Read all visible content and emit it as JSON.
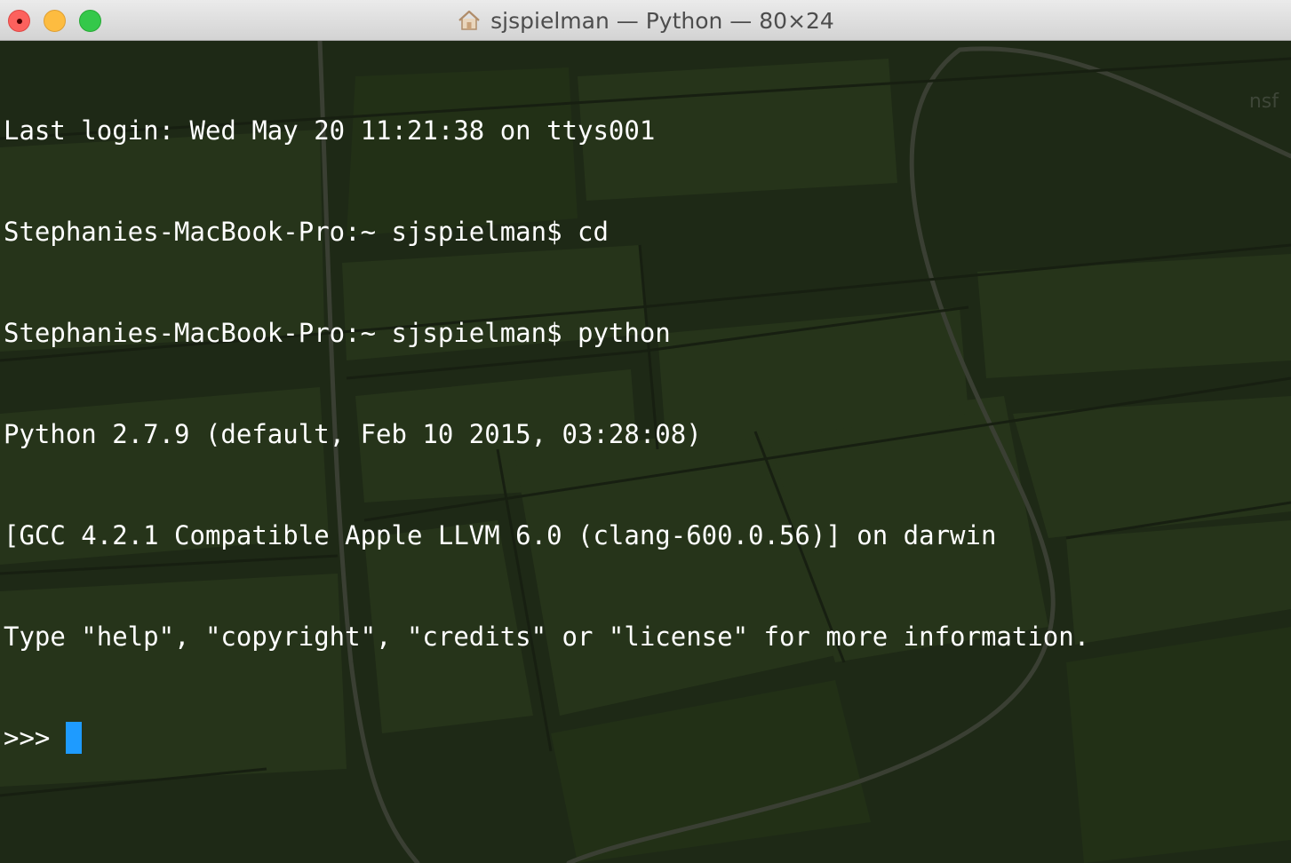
{
  "window": {
    "title": "sjspielman — Python — 80×24",
    "title_icon": "home-folder-icon",
    "traffic_lights": {
      "close": "#fc615d",
      "minimize": "#fdbc40",
      "zoom": "#34c84a"
    }
  },
  "terminal": {
    "lines": [
      "Last login: Wed May 20 11:21:38 on ttys001",
      "Stephanies-MacBook-Pro:~ sjspielman$ cd",
      "Stephanies-MacBook-Pro:~ sjspielman$ python",
      "Python 2.7.9 (default, Feb 10 2015, 03:28:08)",
      "[GCC 4.2.1 Compatible Apple LLVM 6.0 (clang-600.0.56)] on darwin",
      "Type \"help\", \"copyright\", \"credits\" or \"license\" for more information."
    ],
    "prompt": ">>>",
    "cursor_color": "#1e9bff",
    "text_color": "#ffffff",
    "watermark": "nsf"
  }
}
